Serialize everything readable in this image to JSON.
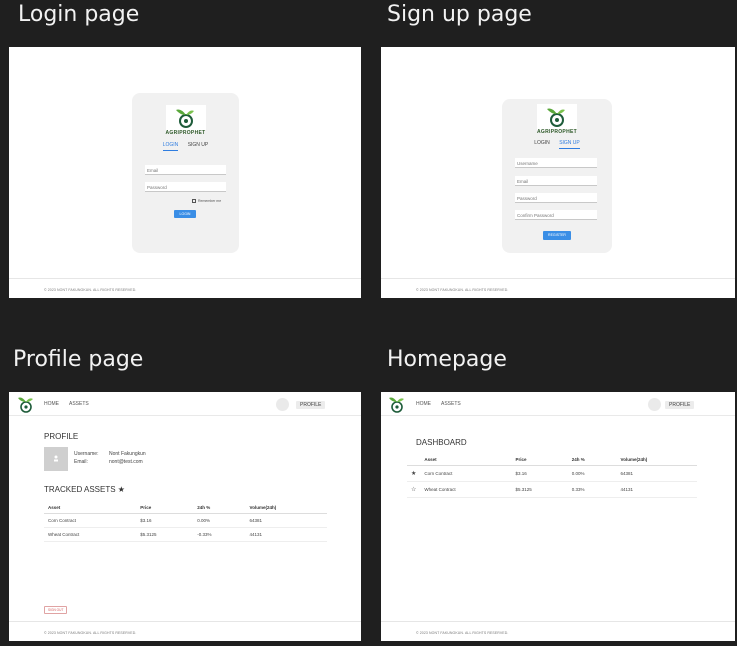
{
  "titles": {
    "login": "Login page",
    "signup": "Sign up page",
    "profile": "Profile page",
    "home": "Homepage"
  },
  "brand": "AGRIPROPHET",
  "tabs": {
    "login": "LOGIN",
    "signup": "SIGN UP"
  },
  "login": {
    "email": "Email",
    "password": "Password",
    "remember": "Remember me",
    "button": "LOGIN"
  },
  "signup": {
    "username": "Username",
    "email": "Email",
    "password": "Password",
    "confirm": "Confirm Password",
    "button": "REGISTER"
  },
  "footer": "© 2023 NONT FAKUNGKUN. ALL RIGHTS RESERVED.",
  "nav": {
    "home": "HOME",
    "assets": "ASSETS",
    "profile": "PROFILE"
  },
  "profile": {
    "heading": "PROFILE",
    "username_label": "Username:",
    "username": "Nont Fakungkun",
    "email_label": "Email:",
    "email": "nont@test.com",
    "tracked_heading": "TRACKED ASSETS ★",
    "signout": "SIGN OUT"
  },
  "home": {
    "heading": "DASHBOARD"
  },
  "table": {
    "headers": [
      "Asset",
      "Price",
      "24h %",
      "Volume(24h)"
    ],
    "rows": [
      {
        "asset": "Corn Contract",
        "price": "$3.16",
        "change": "0.00%",
        "volume": "64381"
      },
      {
        "asset": "Wheat Contract",
        "price": "$5.3125",
        "change": "-0.33%",
        "volume": "44131"
      }
    ]
  },
  "home_table": {
    "rows": [
      {
        "star": "★",
        "asset": "Corn Contract",
        "price": "$3.16",
        "change": "0.00%",
        "volume": "64381"
      },
      {
        "star": "☆",
        "asset": "Wheat Contract",
        "price": "$5.3125",
        "change": "0.33%",
        "volume": "44131"
      }
    ]
  },
  "colors": {
    "accent": "#3a8ee6",
    "positive": "#2fb85a",
    "brand_green": "#2f5a2a",
    "background": "#1f1f1f"
  }
}
